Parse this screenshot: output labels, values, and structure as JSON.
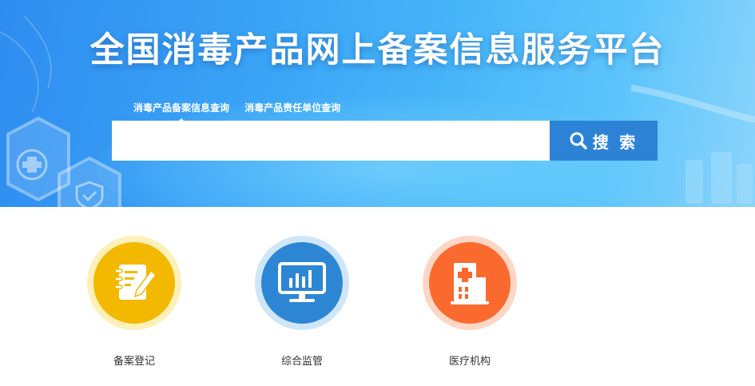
{
  "banner": {
    "title": "全国消毒产品网上备案信息服务平台"
  },
  "search": {
    "tabs": [
      {
        "label": "消毒产品备案信息查询",
        "active": true
      },
      {
        "label": "消毒产品责任单位查询",
        "active": false
      }
    ],
    "input_value": "",
    "button_label": "搜 索",
    "button_icon": "search-icon"
  },
  "services": [
    {
      "label": "备案登记",
      "icon": "register-notebook-icon",
      "color": "#f3b800",
      "ring": "#fdf0b8"
    },
    {
      "label": "综合监管",
      "icon": "monitor-chart-icon",
      "color": "#2d86d3",
      "ring": "#cfe6f8"
    },
    {
      "label": "医疗机构",
      "icon": "hospital-icon",
      "color": "#fa6a2e",
      "ring": "#fdd6c6"
    }
  ],
  "colors": {
    "banner_start": "#2f8df0",
    "banner_end": "#8bd4fb",
    "search_button": "#2c83d6"
  }
}
